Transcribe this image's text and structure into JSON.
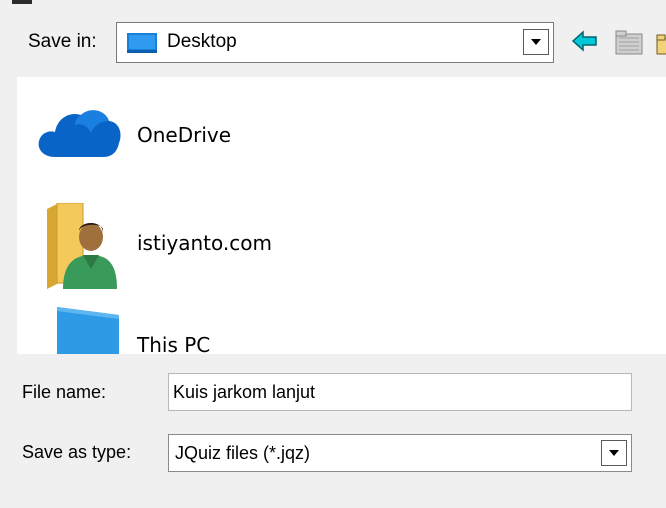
{
  "save_in": {
    "label": "Save in:",
    "value": "Desktop",
    "folder_icon": "desktop-icon"
  },
  "toolbar": {
    "back_icon": "back-arrow-icon",
    "up_icon": "up-folder-icon",
    "new_folder_icon": "new-folder-icon"
  },
  "items": [
    {
      "label": "OneDrive",
      "icon": "onedrive-cloud-icon"
    },
    {
      "label": "istiyanto.com",
      "icon": "user-folder-icon"
    },
    {
      "label": "This PC",
      "icon": "monitor-icon"
    }
  ],
  "file_name": {
    "label": "File name:",
    "value": "Kuis jarkom lanjut"
  },
  "save_as_type": {
    "label": "Save as type:",
    "value": "JQuiz files (*.jqz)"
  },
  "colors": {
    "cloud_blue": "#0a64c8",
    "folder_yellow": "#e8b94a",
    "monitor_blue": "#2e9ae6",
    "back_arrow_cyan": "#00c8d8"
  }
}
